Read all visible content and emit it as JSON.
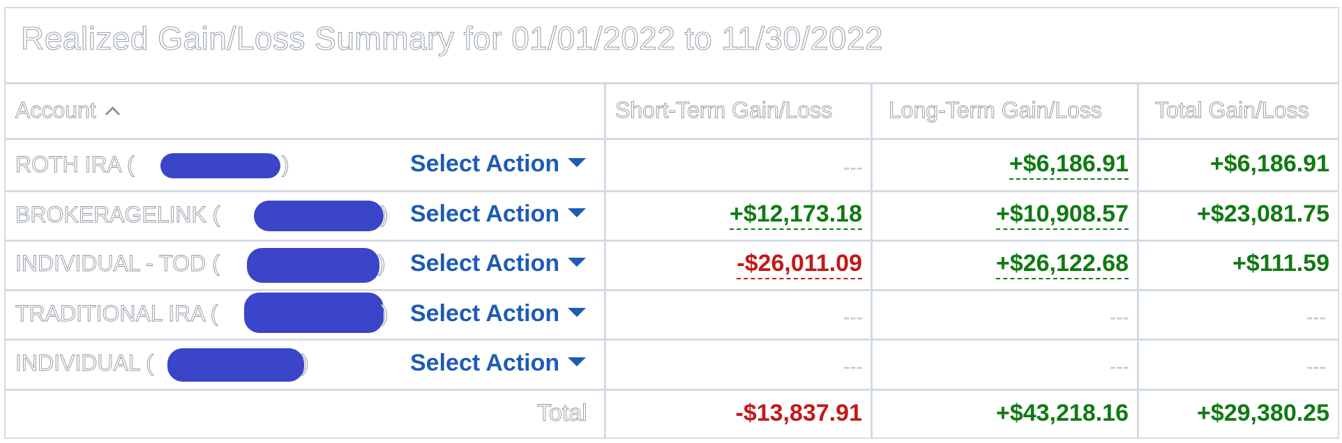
{
  "title": "Realized Gain/Loss Summary for 01/01/2022 to 11/30/2022",
  "columns": {
    "account": "Account",
    "short_term": "Short-Term Gain/Loss",
    "long_term": "Long-Term Gain/Loss",
    "total": "Total Gain/Loss"
  },
  "action_label": "Select Action",
  "empty_value": "---",
  "rows": [
    {
      "account": "ROTH IRA (",
      "account_close": ")",
      "short": "",
      "long": "+$6,186.91",
      "total": "+$6,186.91"
    },
    {
      "account": "BROKERAGELINK (",
      "account_close": ")",
      "short": "+$12,173.18",
      "long": "+$10,908.57",
      "total": "+$23,081.75"
    },
    {
      "account": "INDIVIDUAL - TOD (",
      "account_close": ")",
      "short": "-$26,011.09",
      "long": "+$26,122.68",
      "total": "+$111.59"
    },
    {
      "account": "TRADITIONAL IRA (",
      "account_close": ")",
      "short": "",
      "long": "",
      "total": ""
    },
    {
      "account": "INDIVIDUAL (",
      "account_close": ")",
      "short": "",
      "long": "",
      "total": ""
    }
  ],
  "totals": {
    "label": "Total",
    "short": "-$13,837.91",
    "long": "+$43,218.16",
    "total": "+$29,380.25"
  },
  "colors": {
    "gain": "#0f7a12",
    "loss": "#c41818",
    "action": "#1d5bb5",
    "redaction": "#3a45c9"
  }
}
